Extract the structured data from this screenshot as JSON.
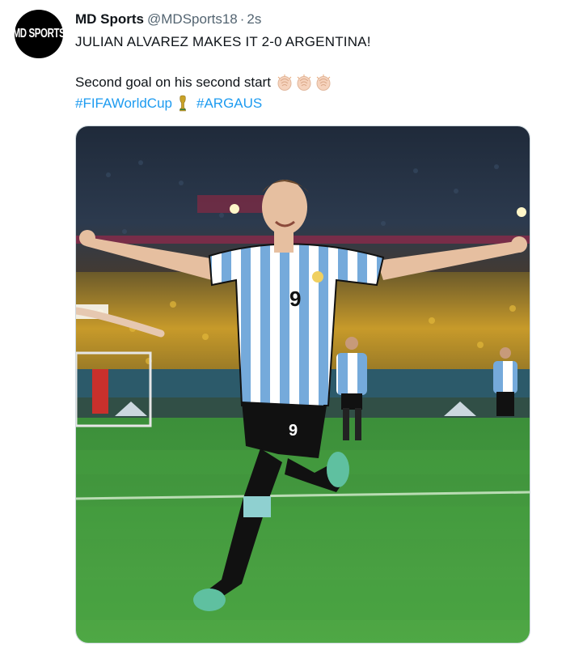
{
  "tweet": {
    "avatar_text": "MD SPORTS",
    "display_name": "MD Sports",
    "handle": "@MDSports18",
    "separator": "·",
    "time": "2s",
    "line1": "JULIAN ALVAREZ MAKES IT 2-0 ARGENTINA!",
    "line2": "Second goal on his second start",
    "hashtags": [
      "#FIFAWorldCup",
      "#ARGAUS"
    ],
    "icons": [
      "clap-icon",
      "clap-icon",
      "clap-icon",
      "trophy-icon"
    ],
    "jersey_number": "9"
  },
  "colors": {
    "link": "#1d9bf0",
    "secondary_text": "#536471",
    "jersey_blue": "#75aadb",
    "pitch_green": "#3f9a3c"
  }
}
